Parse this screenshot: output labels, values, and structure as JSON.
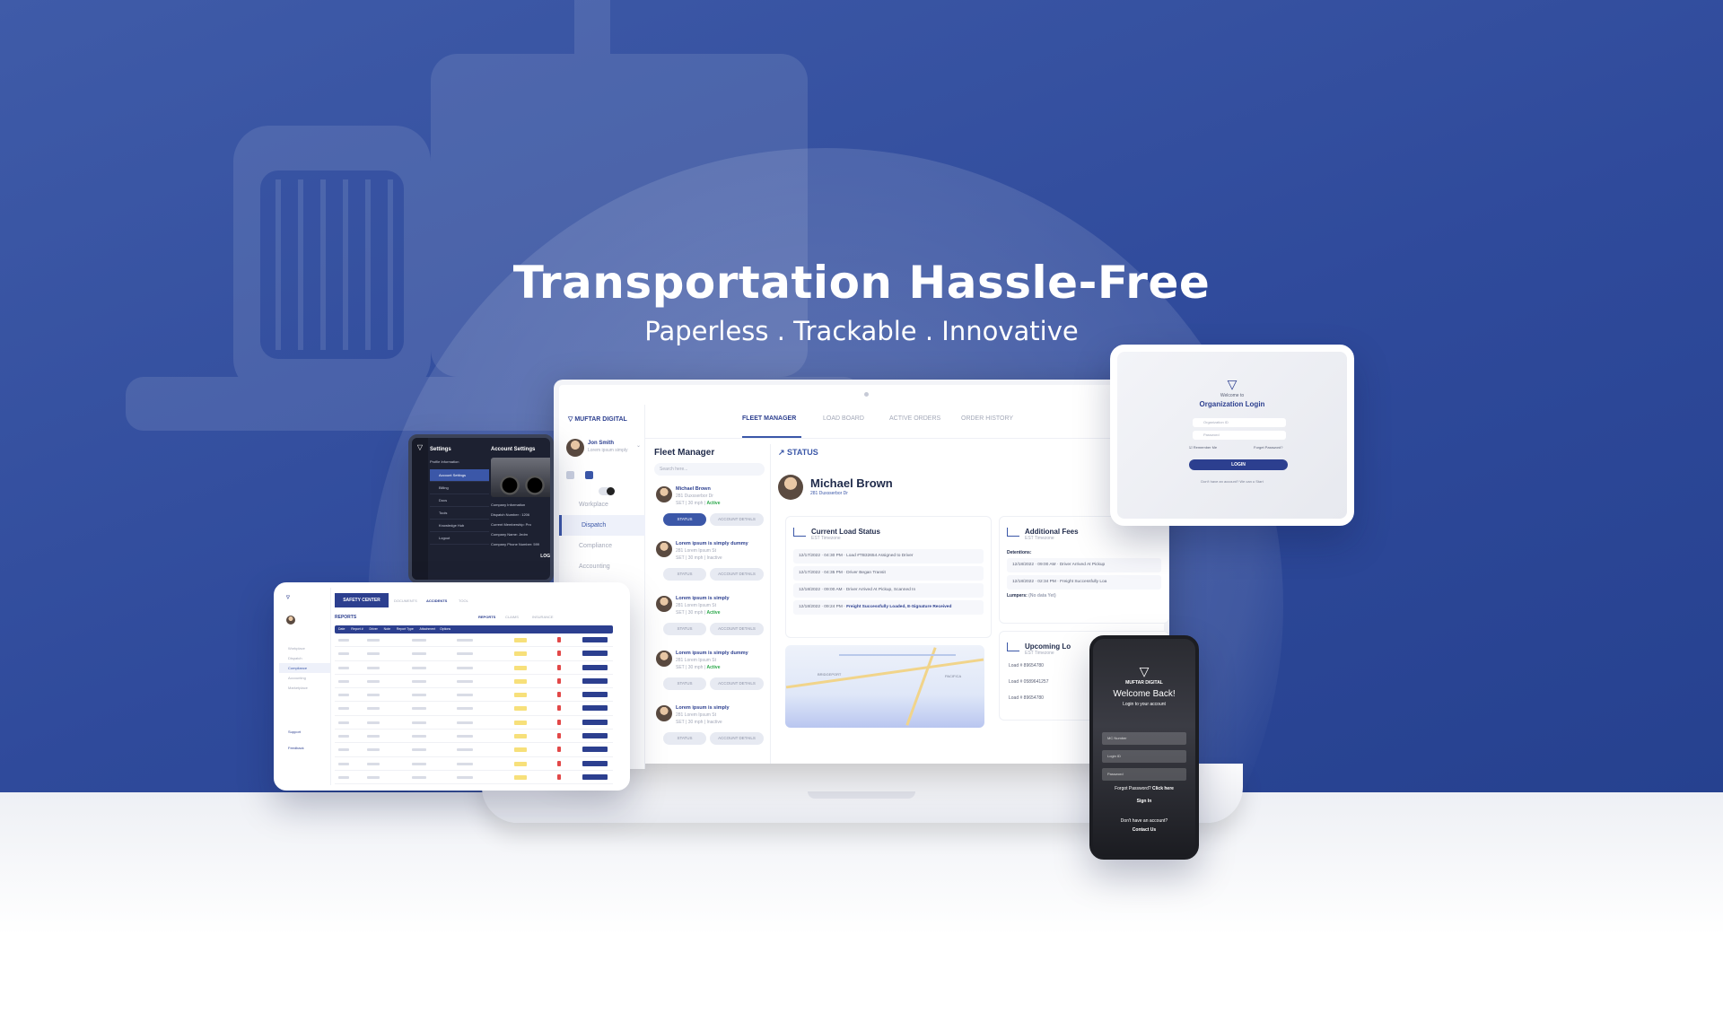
{
  "hero": {
    "title": "Transportation Hassle-Free",
    "subtitle": "Paperless . Trackable . Innovative"
  },
  "brand": {
    "name": "MUFTAR DIGITAL",
    "accent": "#2c3f8f",
    "bg": "#3450a0"
  },
  "laptop": {
    "tabs": [
      "FLEET MANAGER",
      "LOAD BOARD",
      "ACTIVE ORDERS",
      "ORDER HISTORY"
    ],
    "profile_name": "Jon Smith",
    "profile_sub": "Lorem ipsum simply",
    "nav": [
      "Workplace",
      "Dispatch",
      "Compliance",
      "Accounting"
    ],
    "fleet_title": "Fleet Manager",
    "search_placeholder": "Search here...",
    "drivers": [
      {
        "name": "Michael Brown",
        "sub": "281 Duxsserbor Dr",
        "meta": "SET | 30 mph |",
        "status": "Active",
        "btn1": "STATUS",
        "btn2": "ACCOUNT DETAILS"
      },
      {
        "name": "Lorem ipsum is simply dummy",
        "sub": "281 Lorem Ipsum St",
        "meta": "SET | 30 mph |",
        "status": "Inactive",
        "btn1": "STATUS",
        "btn2": "ACCOUNT DETAILS"
      },
      {
        "name": "Lorem ipsum is simply",
        "sub": "281 Lorem Ipsum St",
        "meta": "SET | 30 mph |",
        "status": "Active",
        "btn1": "STATUS",
        "btn2": "ACCOUNT DETAILS"
      },
      {
        "name": "Lorem ipsum is simply dummy",
        "sub": "281 Lorem Ipsum St",
        "meta": "SET | 30 mph |",
        "status": "Active",
        "btn1": "STATUS",
        "btn2": "ACCOUNT DETAILS"
      },
      {
        "name": "Lorem ipsum is simply",
        "sub": "281 Lorem Ipsum St",
        "meta": "SET | 30 mph |",
        "status": "Inactive",
        "btn1": "STATUS",
        "btn2": "ACCOUNT DETAILS"
      }
    ],
    "status_title": "STATUS",
    "selected_driver": "Michael Brown",
    "selected_address": "281 Duxsserbor Dr",
    "current_load": {
      "title": "Current Load Status",
      "sub": "EST Timezone",
      "rows": [
        {
          "date": "12/17/2022",
          "time": "04:30 PM",
          "text": "Load #TB32654 Assigned to Driver"
        },
        {
          "date": "12/17/2022",
          "time": "04:35 PM",
          "text": "Driver Began Transit"
        },
        {
          "date": "12/18/2022",
          "time": "09:00 AM",
          "text": "Driver Arrived At Pickup, Scanned In"
        },
        {
          "date": "12/18/2022",
          "time": "09:24 PM",
          "text": "Freight Successfully Loaded, E-Signature Received"
        }
      ]
    },
    "additional_fees": {
      "title": "Additional Fees",
      "sub": "EST Timezone",
      "detentions_label": "Detentions:",
      "rows": [
        {
          "date": "12/18/2022",
          "time": "09:00 AM",
          "text": "Driver Arrived At Pickup"
        },
        {
          "date": "12/18/2022",
          "time": "02:34 PM",
          "text": "Freight Successfully Loa"
        }
      ],
      "lumpers_label": "Lumpers:",
      "lumpers_value": "(No data Yet)"
    },
    "upcoming": {
      "title": "Upcoming Lo",
      "sub": "EST Timezone",
      "loads": [
        "Load # 89654780",
        "Load # 0589641257",
        "Load # 89654780"
      ]
    },
    "map_labels": [
      "BRIDGEPORT",
      "PACIFICA"
    ]
  },
  "login_tablet": {
    "welcome": "Welcome to",
    "title": "Organization Login",
    "field1": "Organization ID",
    "field2": "Password",
    "remember": "Remember Me",
    "forgot": "Forget Password?",
    "button": "LOGIN",
    "footer": "Don't have an account? We can u Start"
  },
  "settings": {
    "left_title": "Settings",
    "right_title": "Account Settings",
    "profile_label": "Profile Information",
    "items": [
      "Account Settings",
      "Billing",
      "Docs",
      "Tools",
      "Knowledge Hub",
      "Logout"
    ],
    "company_info": "Company Information",
    "dispatch_number": "Dispatch Number : 1206",
    "membership": "Current Membership: Pro",
    "company_name": "Company Name: Jedm",
    "company_phone": "Company Phone Number: 599",
    "logo_label": "LOGO"
  },
  "safety": {
    "badge": "SAFETY CENTER",
    "tabs": [
      "DOCUMENTS",
      "ACCIDENTS",
      "TOOL"
    ],
    "subtabs": [
      "REPORTS",
      "CLAIMS",
      "INSURANCE"
    ],
    "reports_title": "REPORTS",
    "columns": [
      "Date",
      "Report #",
      "Driver",
      "Note",
      "Report Type",
      "Attachment",
      "Options"
    ],
    "row_count": 11,
    "sidebar": [
      "Workplace",
      "Dispatch",
      "Compliance",
      "Accounting",
      "Marketplace"
    ],
    "support": "Support",
    "feedback": "Feedback"
  },
  "phone": {
    "brand": "MUFTAR DIGITAL",
    "title": "Welcome Back!",
    "subtitle": "Login to your account",
    "field1": "MC Number",
    "field2": "Login ID",
    "field3": "Password",
    "forgot": "Forgot Password?",
    "click_here": "Click here",
    "signin": "Sign In",
    "no_account": "Don't have an account?",
    "contact": "Contact Us"
  }
}
